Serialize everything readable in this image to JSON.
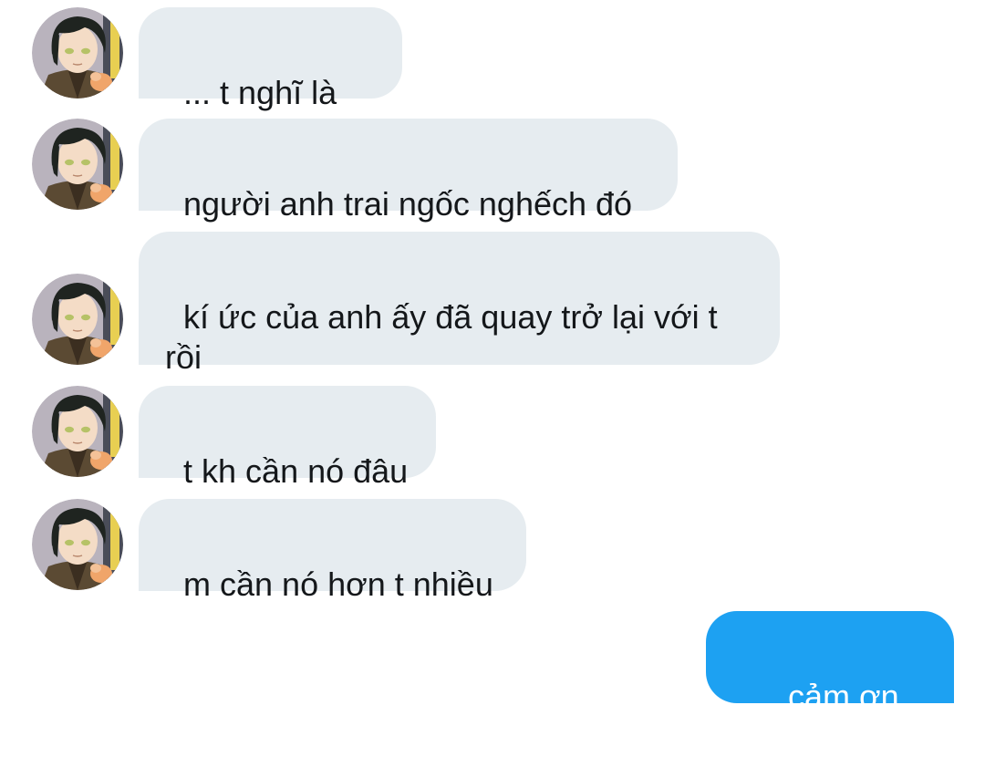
{
  "conversation": {
    "incoming": [
      {
        "text": "... t nghĩ là kh"
      },
      {
        "text": "người anh trai ngốc nghếch đó"
      },
      {
        "text": "kí ức của anh ấy đã quay trở lại với t rồi"
      },
      {
        "text": "t kh cần nó đâu"
      },
      {
        "text": "m cần nó hơn t nhiều"
      }
    ],
    "outgoing": [
      {
        "text": "... cảm ơn m"
      }
    ]
  },
  "colors": {
    "incoming_bubble": "#e6ecf0",
    "incoming_text": "#14171a",
    "outgoing_bubble": "#1da1f2",
    "outgoing_text": "#ffffff"
  },
  "icons": {
    "avatar": "avatar-icon"
  }
}
